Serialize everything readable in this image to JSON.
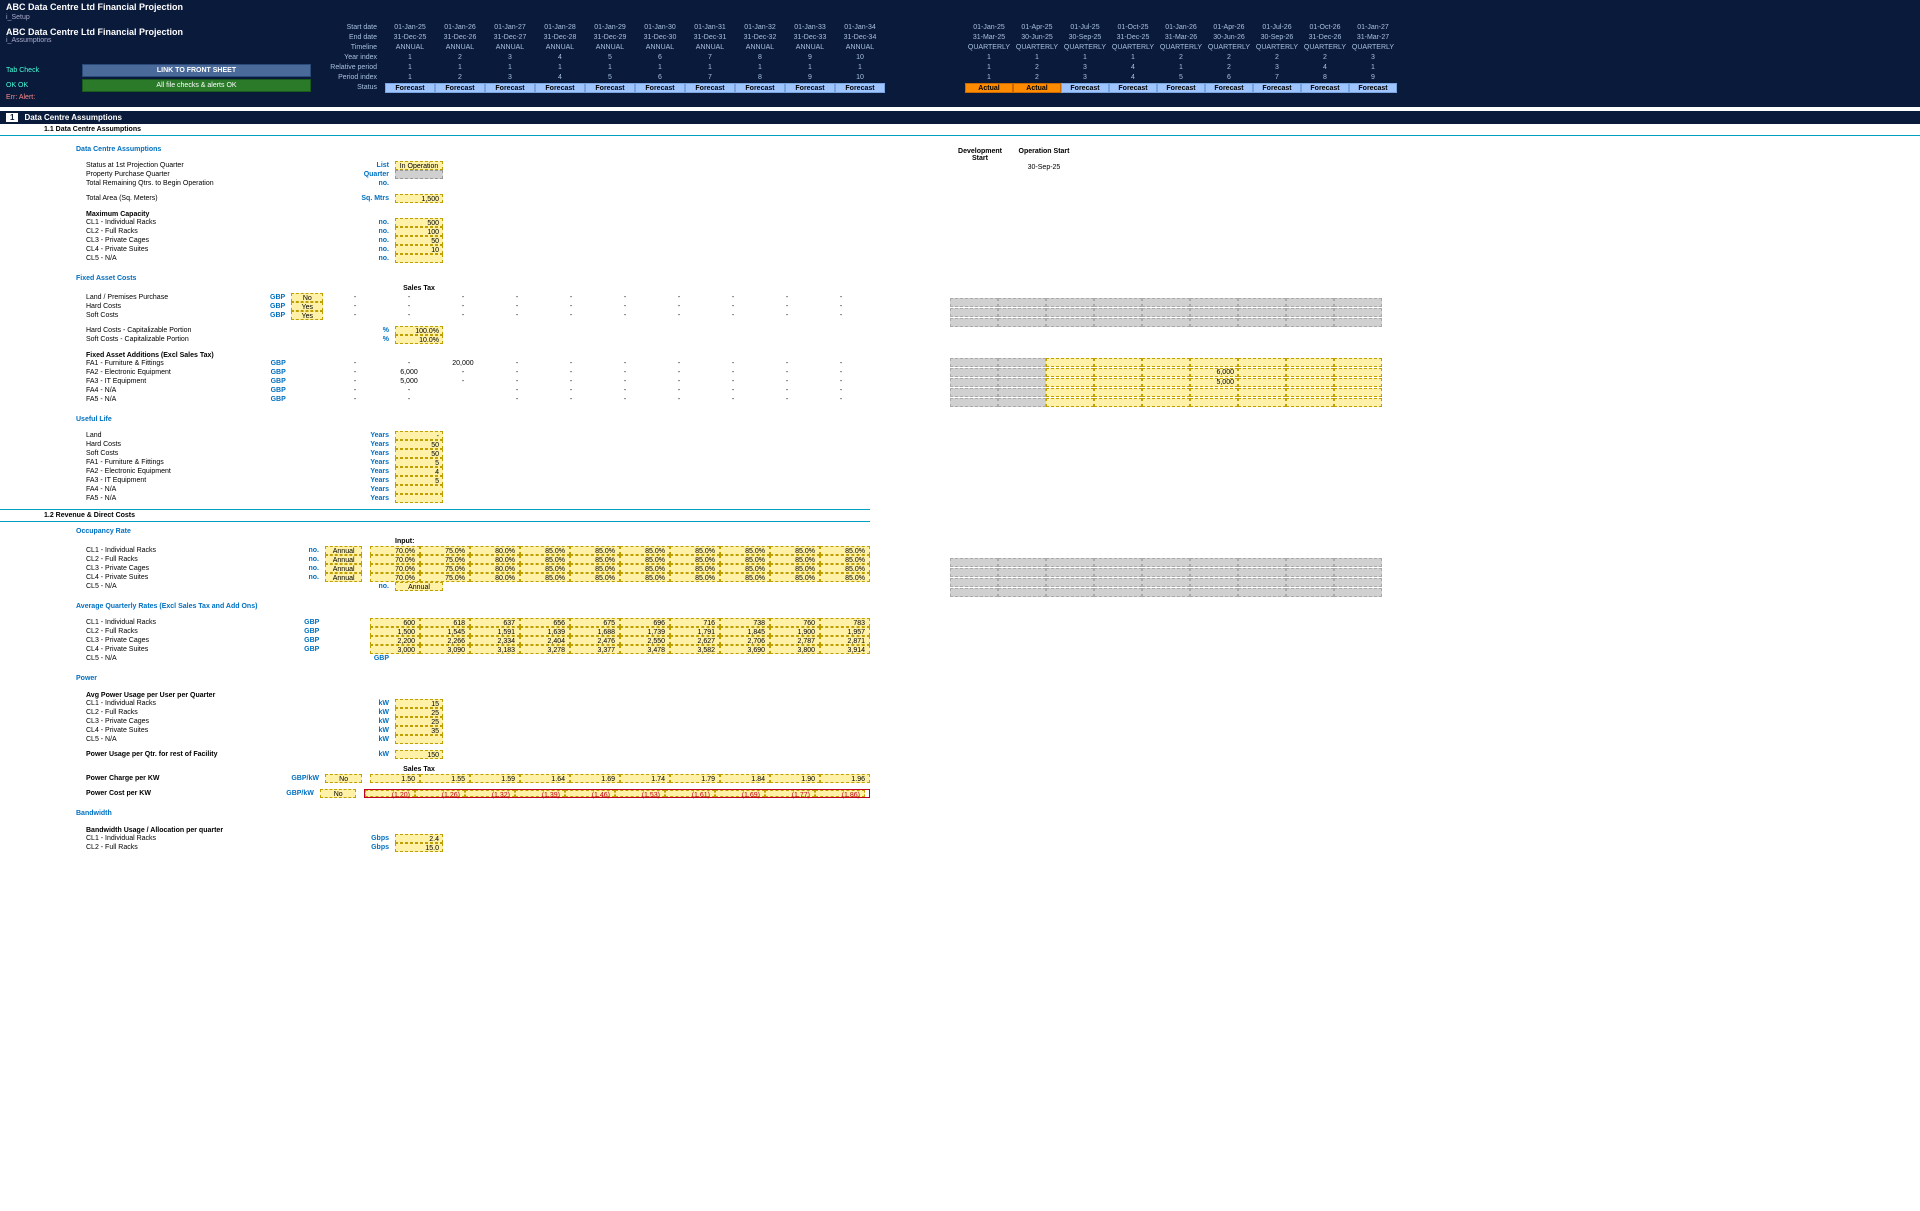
{
  "title": "ABC Data Centre Ltd Financial Projection",
  "bc1": "i_Setup",
  "title2": "ABC Data Centre Ltd Financial Projection",
  "bc2": "i_Assumptions",
  "btn_link": "LINK TO FRONT SHEET",
  "btn_checks": "All file checks & alerts OK",
  "tab_check": "Tab Check",
  "ok_ok": "OK  OK",
  "err_alert": "Err:  Alert:",
  "tl": {
    "labels": [
      "Start date",
      "End date",
      "Timeline",
      "Year index",
      "Relative period",
      "Period index",
      "Status"
    ],
    "annual_dates_start": [
      "01-Jan-25",
      "01-Jan-26",
      "01-Jan-27",
      "01-Jan-28",
      "01-Jan-29",
      "01-Jan-30",
      "01-Jan-31",
      "01-Jan-32",
      "01-Jan-33",
      "01-Jan-34"
    ],
    "annual_dates_end": [
      "31-Dec-25",
      "31-Dec-26",
      "31-Dec-27",
      "31-Dec-28",
      "31-Dec-29",
      "31-Dec-30",
      "31-Dec-31",
      "31-Dec-32",
      "31-Dec-33",
      "31-Dec-34"
    ],
    "annual_tl": [
      "ANNUAL",
      "ANNUAL",
      "ANNUAL",
      "ANNUAL",
      "ANNUAL",
      "ANNUAL",
      "ANNUAL",
      "ANNUAL",
      "ANNUAL",
      "ANNUAL"
    ],
    "annual_yi": [
      "1",
      "2",
      "3",
      "4",
      "5",
      "6",
      "7",
      "8",
      "9",
      "10"
    ],
    "annual_rp": [
      "1",
      "1",
      "1",
      "1",
      "1",
      "1",
      "1",
      "1",
      "1",
      "1"
    ],
    "annual_pi": [
      "1",
      "2",
      "3",
      "4",
      "5",
      "6",
      "7",
      "8",
      "9",
      "10"
    ],
    "annual_status": [
      "Forecast",
      "Forecast",
      "Forecast",
      "Forecast",
      "Forecast",
      "Forecast",
      "Forecast",
      "Forecast",
      "Forecast",
      "Forecast"
    ],
    "q_dates_start": [
      "01-Jan-25",
      "01-Apr-25",
      "01-Jul-25",
      "01-Oct-25",
      "01-Jan-26",
      "01-Apr-26",
      "01-Jul-26",
      "01-Oct-26",
      "01-Jan-27"
    ],
    "q_dates_end": [
      "31-Mar-25",
      "30-Jun-25",
      "30-Sep-25",
      "31-Dec-25",
      "31-Mar-26",
      "30-Jun-26",
      "30-Sep-26",
      "31-Dec-26",
      "31-Mar-27"
    ],
    "q_tl": [
      "QUARTERLY",
      "QUARTERLY",
      "QUARTERLY",
      "QUARTERLY",
      "QUARTERLY",
      "QUARTERLY",
      "QUARTERLY",
      "QUARTERLY",
      "QUARTERLY"
    ],
    "q_yi": [
      "1",
      "1",
      "1",
      "1",
      "2",
      "2",
      "2",
      "2",
      "3"
    ],
    "q_rp": [
      "1",
      "2",
      "3",
      "4",
      "1",
      "2",
      "3",
      "4",
      "1"
    ],
    "q_pi": [
      "1",
      "2",
      "3",
      "4",
      "5",
      "6",
      "7",
      "8",
      "9"
    ],
    "q_status": [
      "Actual",
      "Actual",
      "Forecast",
      "Forecast",
      "Forecast",
      "Forecast",
      "Forecast",
      "Forecast",
      "Forecast"
    ]
  },
  "sec1": "Data Centre Assumptions",
  "sub11": "1.1   Data Centre Assumptions",
  "sub12": "1.2   Revenue & Direct Costs",
  "h_dca": "Data Centre Assumptions",
  "h_fac": "Fixed Asset Costs",
  "h_ul": "Useful Life",
  "h_occ": "Occupancy Rate",
  "h_rates": "Average Quarterly Rates (Excl Sales Tax and Add Ons)",
  "h_power": "Power",
  "h_band": "Bandwidth",
  "dev_start": "Development Start",
  "op_start": "Operation Start",
  "op_date": "30-Sep-25",
  "status_label": "Status at 1st Projection Quarter",
  "status_val": "In Operation",
  "ppq": "Property Purchase Quarter",
  "trq": "Total Remaining Qtrs. to Begin Operation",
  "area_label": "Total Area (Sq. Meters)",
  "area_val": "1,500",
  "maxcap": "Maximum Capacity",
  "cl": [
    "CL1 - Individual Racks",
    "CL2 - Full Racks",
    "CL3 - Private Cages",
    "CL4 - Private Suites",
    "CL5 - N/A"
  ],
  "cap": [
    "500",
    "100",
    "50",
    "10",
    ""
  ],
  "u_no": "no.",
  "u_list": "List",
  "u_qtr": "Quarter",
  "u_sqm": "Sq. Mtrs",
  "u_gbp": "GBP",
  "u_pct": "%",
  "u_yrs": "Years",
  "u_ann": "Annual",
  "u_kw": "kW",
  "u_gbpkw": "GBP/kW",
  "u_gbps": "Gbps",
  "salestax": "Sales Tax",
  "input": "Input:",
  "fac": {
    "land": "Land / Premises Purchase",
    "land_v": "No",
    "hard": "Hard Costs",
    "hard_v": "Yes",
    "soft": "Soft Costs",
    "soft_v": "Yes",
    "hcap": "Hard Costs - Capitalizable Portion",
    "hcap_v": "100.0%",
    "scap": "Soft Costs - Capitalizable Portion",
    "scap_v": "10.0%",
    "faa": "Fixed Asset Additions (Excl Sales Tax)",
    "fa": [
      "FA1 - Furniture & Fittings",
      "FA2 - Electronic Equipment",
      "FA3 - IT Equipment",
      "FA4 - N/A",
      "FA5 - N/A"
    ],
    "fa_row1": [
      "-",
      "-",
      "20,000",
      "-",
      "-",
      "-",
      "-",
      "-",
      "-",
      "-"
    ],
    "fa_row2": [
      "-",
      "6,000",
      "-",
      "-",
      "-",
      "-",
      "-",
      "-",
      "-",
      "-"
    ],
    "fa_row3": [
      "-",
      "5,000",
      "-",
      "-",
      "-",
      "-",
      "-",
      "-",
      "-",
      "-"
    ],
    "fa_row4": [
      "-",
      "-",
      "",
      "-",
      "-",
      "-",
      "-",
      "-",
      "-",
      "-"
    ],
    "fa_row5": [
      "-",
      "-",
      "",
      "-",
      "-",
      "-",
      "-",
      "-",
      "-",
      "-"
    ],
    "fa_q2": [
      "",
      "",
      "",
      "",
      "",
      "6,000",
      "",
      "",
      ""
    ],
    "fa_q3": [
      "",
      "",
      "",
      "",
      "",
      "5,000",
      "",
      "",
      ""
    ]
  },
  "ul": {
    "items": [
      "Land",
      "Hard Costs",
      "Soft Costs",
      "FA1 - Furniture & Fittings",
      "FA2 - Electronic Equipment",
      "FA3 - IT Equipment",
      "FA4 - N/A",
      "FA5 - N/A"
    ],
    "vals": [
      "-",
      "50",
      "50",
      "5",
      "4",
      "5",
      "",
      ""
    ]
  },
  "occ": {
    "r1": [
      "70.0%",
      "75.0%",
      "80.0%",
      "85.0%",
      "85.0%",
      "85.0%",
      "85.0%",
      "85.0%",
      "85.0%",
      "85.0%"
    ],
    "r2": [
      "70.0%",
      "75.0%",
      "80.0%",
      "85.0%",
      "85.0%",
      "85.0%",
      "85.0%",
      "85.0%",
      "85.0%",
      "85.0%"
    ],
    "r3": [
      "70.0%",
      "75.0%",
      "80.0%",
      "85.0%",
      "85.0%",
      "85.0%",
      "85.0%",
      "85.0%",
      "85.0%",
      "85.0%"
    ],
    "r4": [
      "70.0%",
      "75.0%",
      "80.0%",
      "85.0%",
      "85.0%",
      "85.0%",
      "85.0%",
      "85.0%",
      "85.0%",
      "85.0%"
    ]
  },
  "rates": {
    "r1": [
      "600",
      "618",
      "637",
      "656",
      "675",
      "696",
      "716",
      "738",
      "760",
      "783"
    ],
    "r2": [
      "1,500",
      "1,545",
      "1,591",
      "1,639",
      "1,688",
      "1,739",
      "1,791",
      "1,845",
      "1,900",
      "1,957"
    ],
    "r3": [
      "2,200",
      "2,266",
      "2,334",
      "2,404",
      "2,476",
      "2,550",
      "2,627",
      "2,706",
      "2,787",
      "2,871"
    ],
    "r4": [
      "3,000",
      "3,090",
      "3,183",
      "3,278",
      "3,377",
      "3,478",
      "3,582",
      "3,690",
      "3,800",
      "3,914"
    ]
  },
  "pwr": {
    "avg": "Avg Power Usage per User per Quarter",
    "vals": [
      "15",
      "25",
      "25",
      "35",
      ""
    ],
    "rest": "Power Usage per Qtr. for rest of Facility",
    "rest_v": "150",
    "charge": "Power Charge per KW",
    "charge_v": "No",
    "charge_row": [
      "1.50",
      "1.55",
      "1.59",
      "1.64",
      "1.69",
      "1.74",
      "1.79",
      "1.84",
      "1.90",
      "1.96"
    ],
    "cost": "Power Cost per KW",
    "cost_v": "No",
    "cost_row": [
      "(1.20)",
      "(1.26)",
      "(1.32)",
      "(1.39)",
      "(1.46)",
      "(1.53)",
      "(1.61)",
      "(1.69)",
      "(1.77)",
      "(1.86)"
    ]
  },
  "bw": {
    "alloc": "Bandwidth Usage / Allocation per quarter",
    "vals": [
      "2.4",
      "15.0"
    ]
  }
}
